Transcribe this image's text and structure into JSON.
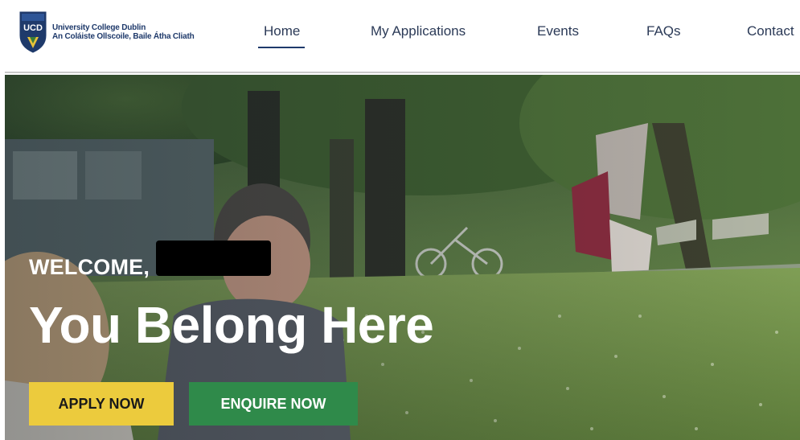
{
  "brand": {
    "crest_letters": "UCD",
    "name_en": "University College Dublin",
    "name_ga": "An Coláiste Ollscoile, Baile Átha Cliath",
    "colors": {
      "navy": "#1f3a6b",
      "gold": "#e8c23a"
    }
  },
  "nav": {
    "items": [
      {
        "label": "Home",
        "active": true
      },
      {
        "label": "My Applications",
        "active": false
      },
      {
        "label": "Events",
        "active": false
      },
      {
        "label": "FAQs",
        "active": false
      },
      {
        "label": "Contact",
        "active": false
      }
    ]
  },
  "hero": {
    "welcome": "WELCOME,",
    "headline": "You Belong Here",
    "buttons": {
      "apply": "APPLY NOW",
      "enquire": "ENQUIRE NOW"
    },
    "colors": {
      "apply_bg": "#eccb3d",
      "enquire_bg": "#2f8a4a"
    }
  }
}
